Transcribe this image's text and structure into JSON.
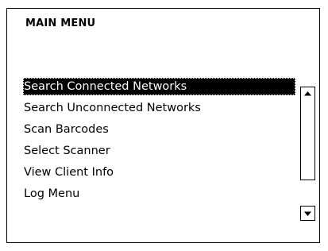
{
  "menu": {
    "title": "MAIN MENU",
    "selected_index": 0,
    "items": [
      "Search Connected Networks",
      "Search Unconnected Networks",
      "Scan Barcodes",
      "Select Scanner",
      "View Client Info",
      "Log Menu"
    ]
  },
  "scrollbar": {
    "up_icon": "arrow-up-icon",
    "down_icon": "arrow-down-icon"
  },
  "colors": {
    "selection_background": "#000000",
    "selection_text": "#ffffff",
    "background": "#ffffff",
    "border": "#000000"
  }
}
